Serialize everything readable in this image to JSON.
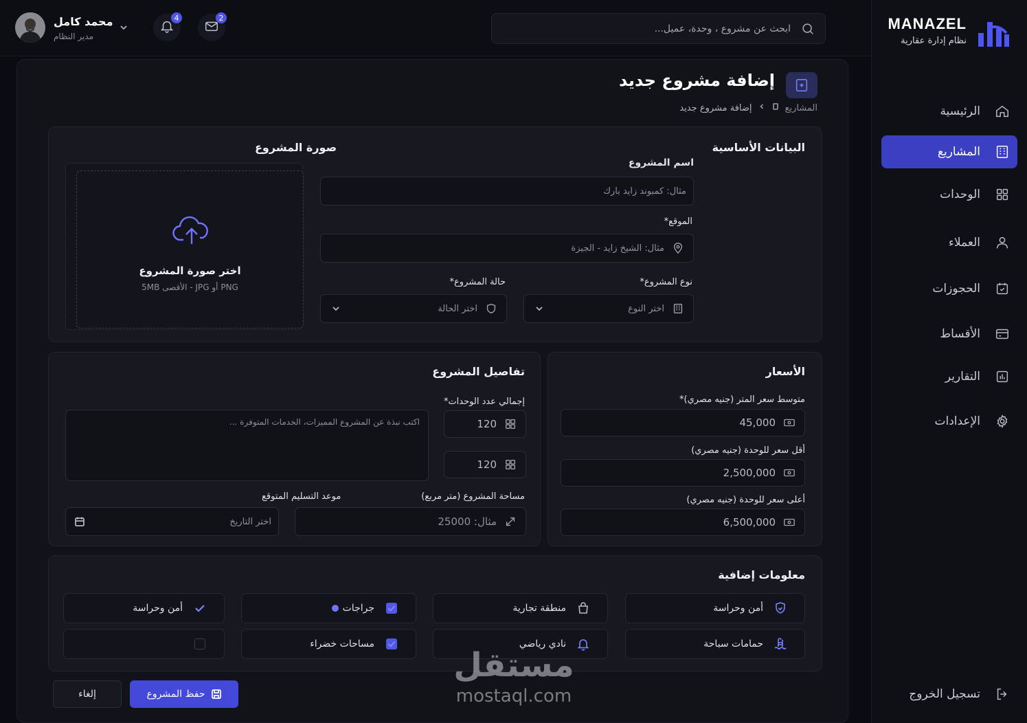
{
  "brand": {
    "name": "MANAZEL",
    "subtitle": "نظام إدارة عقارية"
  },
  "sidebar": {
    "items": [
      {
        "label": "الرئيسية",
        "icon": "home-icon",
        "active": false
      },
      {
        "label": "المشاريع",
        "icon": "building-icon",
        "active": true
      },
      {
        "label": "الوحدات",
        "icon": "grid-icon",
        "active": false
      },
      {
        "label": "العملاء",
        "icon": "user-icon",
        "active": false
      },
      {
        "label": "الحجوزات",
        "icon": "calendar-check-icon",
        "active": false
      },
      {
        "label": "الأقساط",
        "icon": "installments-icon",
        "active": false
      },
      {
        "label": "التقارير",
        "icon": "chart-icon",
        "active": false
      },
      {
        "label": "الإعدادات",
        "icon": "gear-icon",
        "active": false
      }
    ],
    "logout": "تسجيل الخروج"
  },
  "topbar": {
    "search_placeholder": "ابحث عن مشروع ، وحدة، عميل...",
    "notifications_count": "4",
    "messages_count": "2",
    "user_name": "محمد كامل",
    "user_role": "مدير النظام"
  },
  "page": {
    "title": "إضافة مشروع جديد",
    "breadcrumb_parent": "المشاريع",
    "breadcrumb_current": "إضافة مشروع جديد"
  },
  "basic": {
    "title": "البيانات الأساسية",
    "name_label": "اسم المشروع",
    "name_placeholder": "مثال: كمبوند زايد بارك",
    "location_label": "الموقع",
    "location_placeholder": "مثال: الشيخ زايد - الجيزة",
    "type_label": "نوع المشروع",
    "type_placeholder": "اختر النوع",
    "status_label": "حالة المشروع",
    "status_placeholder": "اختر الحالة"
  },
  "image": {
    "title": "صورة المشروع",
    "upload_title": "اختر صورة المشروع",
    "upload_hint": "PNG أو JPG - الأقصى 5MB"
  },
  "prices": {
    "title": "الأسعار",
    "avg_label": "متوسط سعر المتر (جنيه مصري)",
    "avg_value": "45,000",
    "min_label": "أقل سعر للوحدة (جنيه مصري)",
    "min_value": "2,500,000",
    "max_label": "أعلى سعر للوحدة (جنيه مصري)",
    "max_value": "6,500,000"
  },
  "details": {
    "title": "تفاصيل المشروع",
    "units_label": "إجمالي عدد الوحدات",
    "units_value": "120",
    "units_value_2": "120",
    "description_placeholder": "اكتب نبذة عن المشروع المميزات، الخدمات المتوفرة ...",
    "area_label": "مساحة المشروع (متر مربع)",
    "area_placeholder": "مثال: 25000",
    "delivery_label": "موعد التسليم المتوقع",
    "delivery_placeholder": "اختر التاريخ"
  },
  "extra": {
    "title": "معلومات إضافية",
    "items": [
      {
        "label": "أمن وحراسة",
        "icon": "shield-icon"
      },
      {
        "label": "منطقة تجارية",
        "icon": "shopping-bag-icon"
      },
      {
        "label": "جراجات",
        "icon": "checkbox-checked-icon"
      },
      {
        "label": "أمن وحراسة",
        "icon": "check-icon"
      },
      {
        "label": "حمامات سباحة",
        "icon": "pool-icon"
      },
      {
        "label": "نادي رياضي",
        "icon": "bell-icon"
      },
      {
        "label": "مساحات خضراء",
        "icon": "checkbox-checked-icon"
      },
      {
        "label": "",
        "icon": "checkbox-empty-icon"
      }
    ]
  },
  "actions": {
    "save": "حفظ المشروع",
    "cancel": "إلغاء"
  },
  "watermark": {
    "arabic": "مستقل",
    "latin": "mostaql.com"
  },
  "colors": {
    "accent": "#4348d8",
    "background": "#0b0c11",
    "card": "#171820"
  }
}
